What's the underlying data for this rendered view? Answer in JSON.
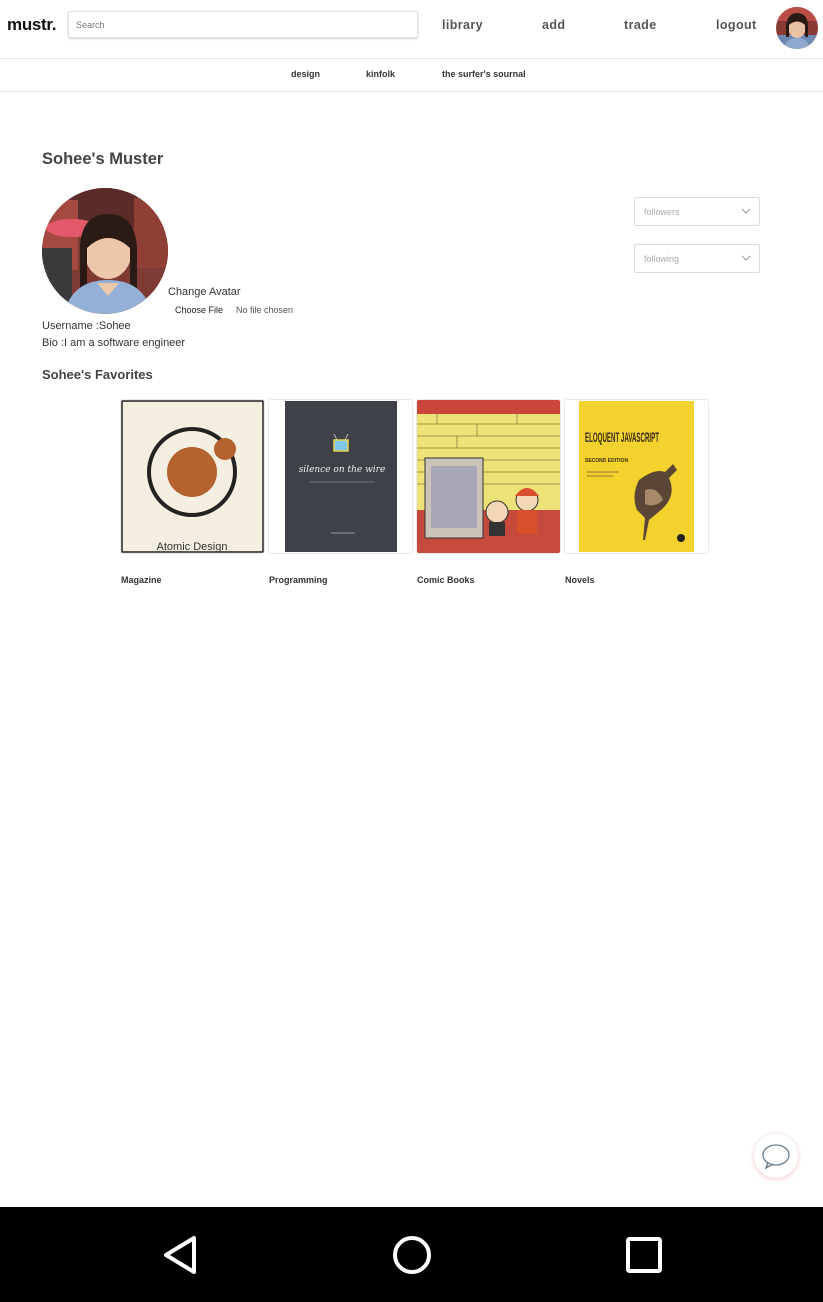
{
  "header": {
    "logo": "mustr.",
    "search_placeholder": "Search",
    "nav": [
      "library",
      "add",
      "trade",
      "logout"
    ]
  },
  "subnav": [
    "design",
    "kinfolk",
    "the surfer's sournal"
  ],
  "profile": {
    "title": "Sohee's Muster",
    "change_avatar": "Change Avatar",
    "choose_file": "Choose File",
    "no_file": "No file chosen",
    "username_label": "Username :",
    "username": "Sohee",
    "bio_label": "Bio :",
    "bio": "I am a software engineer"
  },
  "selects": {
    "followers": "followers",
    "following": "following"
  },
  "favorites": {
    "title": "Sohee's Favorites",
    "items": [
      {
        "label": "Magazine",
        "cover_text": "Atomic Design"
      },
      {
        "label": "Programming",
        "cover_text": "silence on the wire"
      },
      {
        "label": "Comic Books",
        "cover_text": ""
      },
      {
        "label": "Novels",
        "cover_text": "ELOQUENT JAVASCRIPT",
        "cover_sub": "SECOND EDITION"
      }
    ]
  },
  "colors": {
    "accent_chat": "#e8a596",
    "novels_cover": "#f3d22e",
    "programming_cover": "#3f4149",
    "magazine_cover": "#f5efe1"
  },
  "icons": [
    "chat-bubble-icon",
    "back-triangle-icon",
    "home-circle-icon",
    "recents-square-icon",
    "chevron-down-icon"
  ]
}
